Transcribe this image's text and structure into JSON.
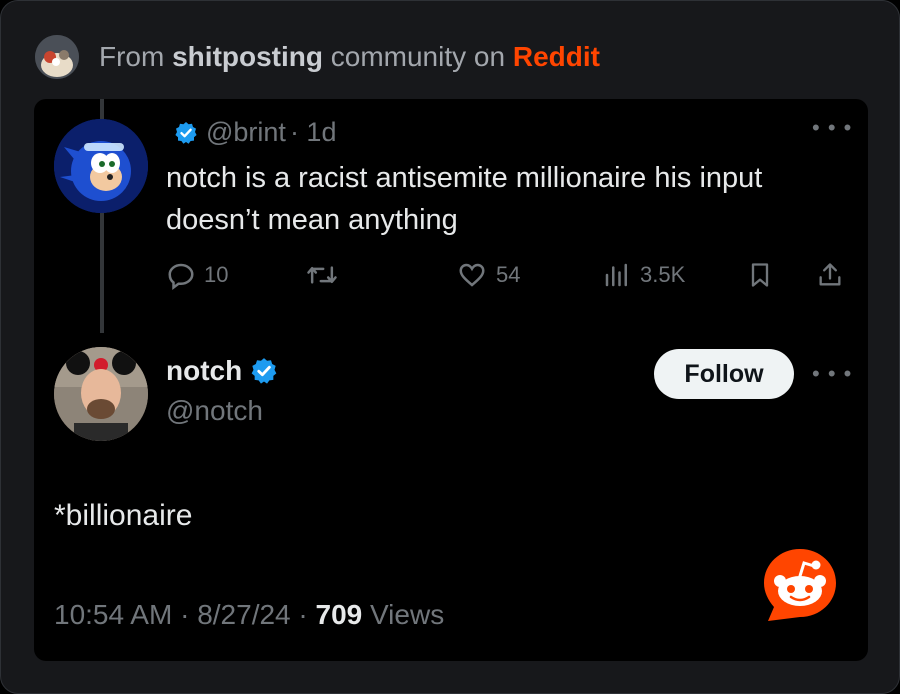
{
  "header": {
    "prefix": "From",
    "community": "shitposting",
    "middle": "community on",
    "platform": "Reddit"
  },
  "reply_tweet": {
    "handle": "@brint",
    "time": "· 1d",
    "text": "notch is a racist antisemite millionaire his input doesn’t mean anything",
    "stats": {
      "replies": "10",
      "likes": "54",
      "views": "3.5K"
    }
  },
  "main_tweet": {
    "name": "notch",
    "handle": "@notch",
    "follow_label": "Follow",
    "text": "*billionaire",
    "time": "10:54 AM",
    "date": "8/27/24",
    "views_count": "709",
    "views_label": "Views"
  },
  "colors": {
    "reddit": "#ff4500",
    "verified": "#1d9bf0",
    "muted": "#71767b"
  },
  "icons": [
    "reply-icon",
    "retweet-icon",
    "like-icon",
    "views-icon",
    "bookmark-icon",
    "share-icon",
    "verified-icon",
    "more-icon",
    "reddit-snoo-icon"
  ]
}
